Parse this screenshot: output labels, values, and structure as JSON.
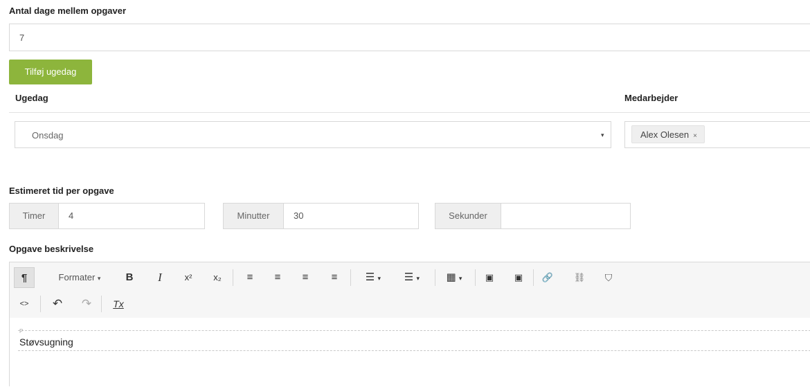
{
  "interval": {
    "label": "Antal dage mellem opgaver",
    "value": "7"
  },
  "add_weekday_button": "Tilføj ugedag",
  "weekday": {
    "label": "Ugedag",
    "selected": "Onsdag"
  },
  "employee": {
    "label": "Medarbejder",
    "tags": [
      "Alex Olesen"
    ],
    "remove_glyph": "×"
  },
  "estimate": {
    "label": "Estimeret tid per opgave",
    "hours_label": "Timer",
    "hours_value": "4",
    "minutes_label": "Minutter",
    "minutes_value": "30",
    "seconds_label": "Sekunder",
    "seconds_value": ""
  },
  "description": {
    "label": "Opgave beskrivelse",
    "format_label": "Formater",
    "content": "Støvsugning",
    "block_marker": "P"
  },
  "toolbar_glyphs": {
    "paragraph": "¶",
    "bold": "B",
    "italic": "I",
    "superscript": "x²",
    "subscript": "x₂",
    "align_left": "≡",
    "align_center": "≡",
    "align_right": "≡",
    "justify": "≡",
    "bullet_list": "☰",
    "numbered_list": "☰",
    "table": "▦",
    "image": "▣",
    "media": "▣",
    "link": "🔗",
    "unlink": "⛓",
    "bookmark": "⛉",
    "source_code": "<>",
    "undo": "↶",
    "redo": "↷",
    "clear_format": "Tx",
    "caret": "▾"
  }
}
